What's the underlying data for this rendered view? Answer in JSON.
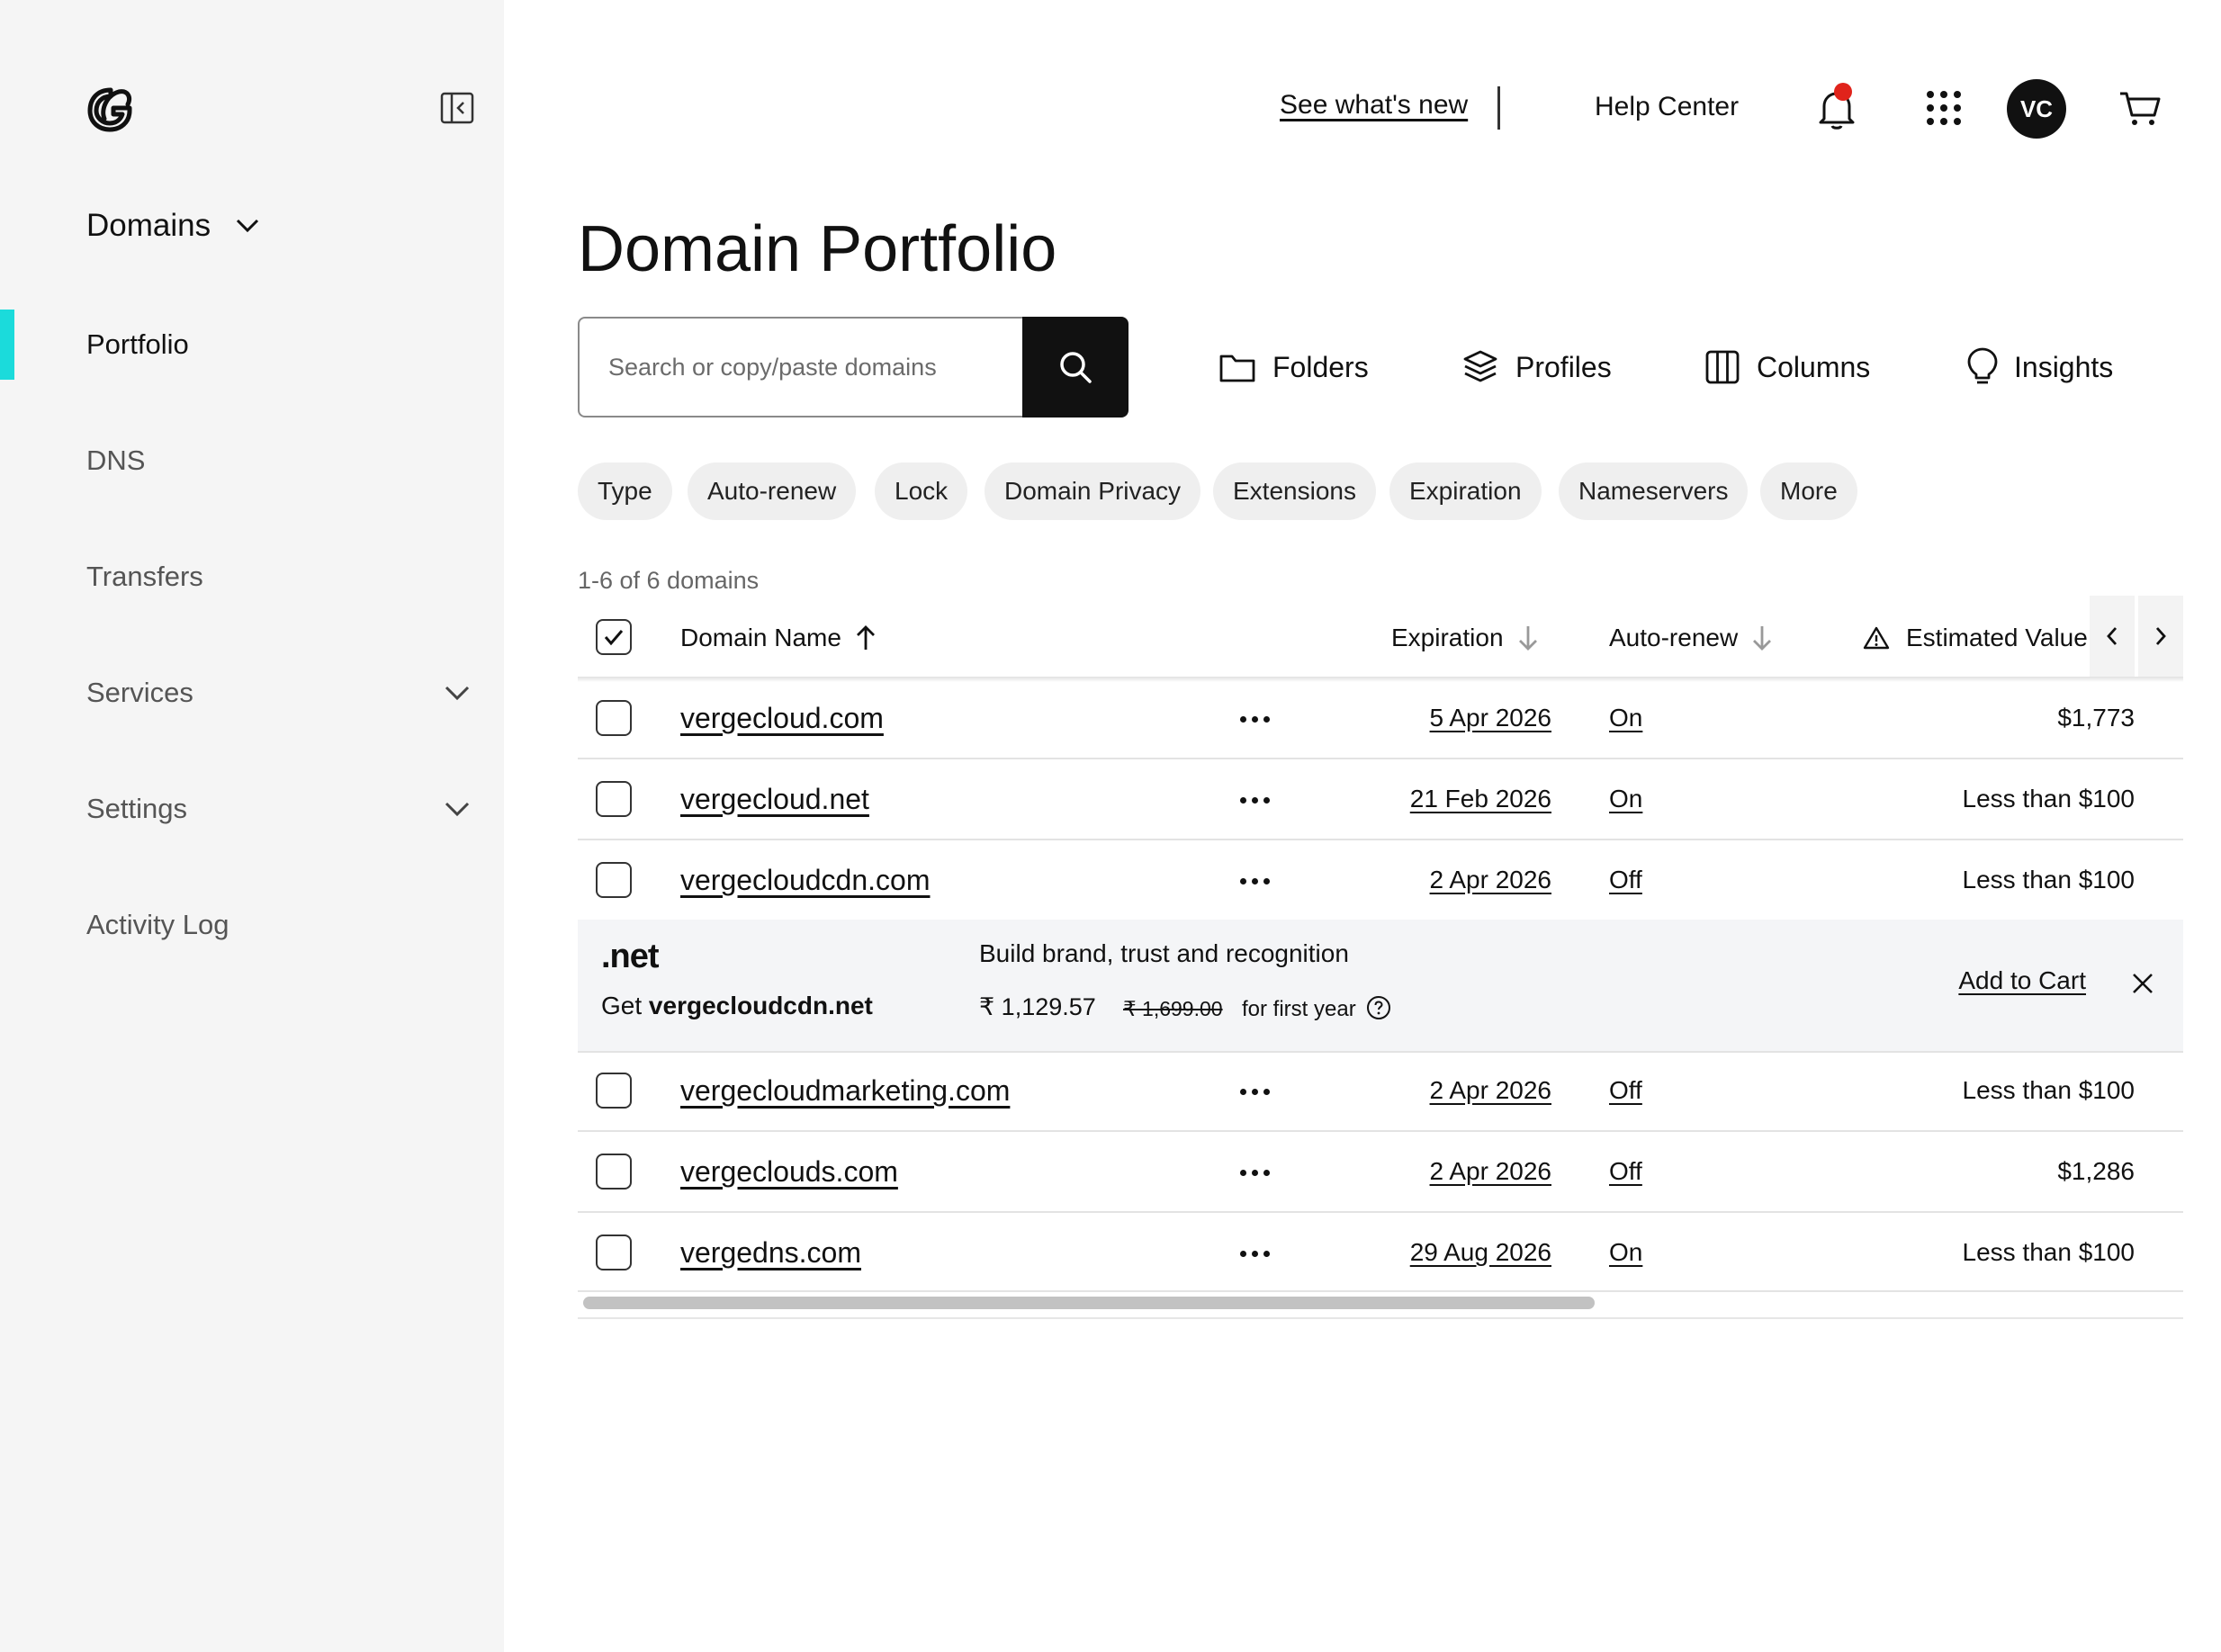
{
  "sidebar": {
    "section_title": "Domains",
    "items": [
      {
        "label": "Portfolio"
      },
      {
        "label": "DNS"
      },
      {
        "label": "Transfers"
      },
      {
        "label": "Services"
      },
      {
        "label": "Settings"
      },
      {
        "label": "Activity Log"
      }
    ]
  },
  "topbar": {
    "whats_new": "See what's new",
    "help_center": "Help Center",
    "avatar_initials": "VC"
  },
  "page": {
    "title": "Domain Portfolio"
  },
  "search": {
    "placeholder": "Search or copy/paste domains",
    "value": ""
  },
  "tools": {
    "folders": "Folders",
    "profiles": "Profiles",
    "columns": "Columns",
    "insights": "Insights"
  },
  "filters": [
    "Type",
    "Auto-renew",
    "Lock",
    "Domain Privacy",
    "Extensions",
    "Expiration",
    "Nameservers",
    "More"
  ],
  "results_count": "1-6 of 6 domains",
  "table": {
    "headers": {
      "domain_name": "Domain Name",
      "expiration": "Expiration",
      "auto_renew": "Auto-renew",
      "estimated_value": "Estimated Value"
    },
    "rows": [
      {
        "domain": "vergecloud.com",
        "expiration": "5 Apr 2026",
        "auto_renew": "On",
        "value": "$1,773"
      },
      {
        "domain": "vergecloud.net",
        "expiration": "21 Feb 2026",
        "auto_renew": "On",
        "value": "Less than $100"
      },
      {
        "domain": "vergecloudcdn.com",
        "expiration": "2 Apr 2026",
        "auto_renew": "Off",
        "value": "Less than $100"
      },
      {
        "domain": "vergecloudmarketing.com",
        "expiration": "2 Apr 2026",
        "auto_renew": "Off",
        "value": "Less than $100"
      },
      {
        "domain": "vergeclouds.com",
        "expiration": "2 Apr 2026",
        "auto_renew": "Off",
        "value": "$1,286"
      },
      {
        "domain": "vergedns.com",
        "expiration": "29 Aug 2026",
        "auto_renew": "On",
        "value": "Less than $100"
      }
    ]
  },
  "promo": {
    "tld": ".net",
    "get_prefix": "Get ",
    "suggested_domain": "vergecloudcdn.net",
    "headline": "Build brand, trust and recognition",
    "price": "₹ 1,129.57",
    "original_price": "₹ 1,699.00",
    "term": "for first year",
    "add_to_cart": "Add to Cart"
  },
  "colors": {
    "accent": "#1bdbdb",
    "notification": "#e0231b",
    "search_button": "#111111",
    "sidebar_bg": "#f5f5f5"
  }
}
